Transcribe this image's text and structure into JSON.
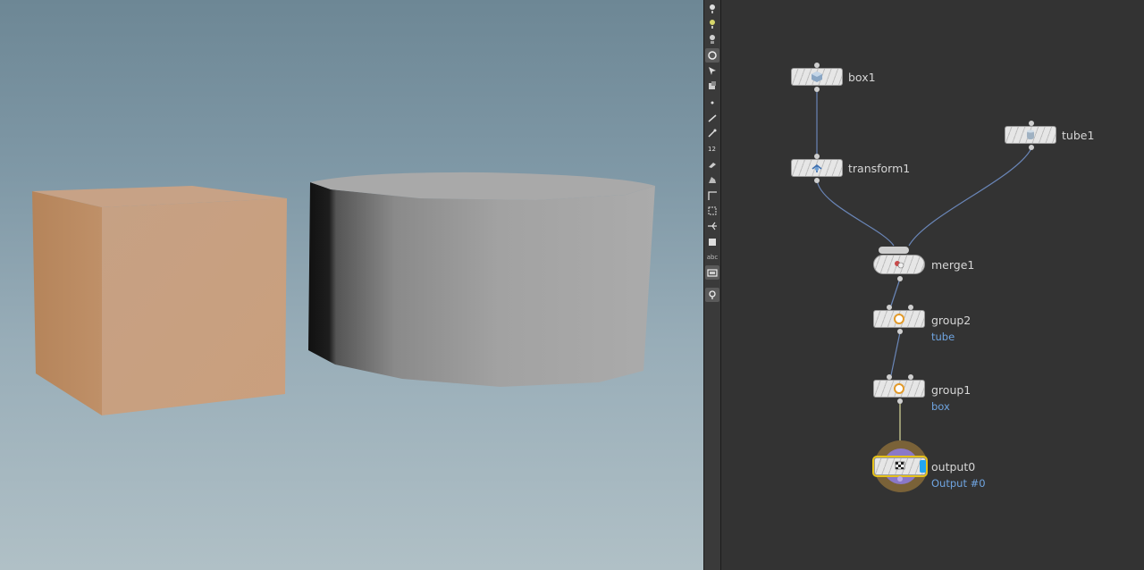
{
  "viewport": {
    "box_color": "#c9a283",
    "tube_color": "#a8a8a8"
  },
  "shelf": {
    "tools": [
      "light-icon",
      "light-icon",
      "light-icon",
      "camera-icon",
      "select-icon",
      "transform-icon",
      "handle-icon",
      "point-icon",
      "edge-icon",
      "pen-icon",
      "number-icon",
      "brush-icon",
      "sculpt-icon",
      "corner-icon",
      "snap-icon",
      "join-icon",
      "box-icon",
      "text-icon",
      "view-icon",
      "pin-icon"
    ],
    "text_tool_label": "abc"
  },
  "network": {
    "wire_color": "#6a86b8",
    "selected_color": "#e6c21a",
    "nodes": {
      "box1": {
        "name": "box1"
      },
      "transform1": {
        "name": "transform1"
      },
      "tube1": {
        "name": "tube1"
      },
      "merge1": {
        "name": "merge1"
      },
      "group2": {
        "name": "group2",
        "comment": "tube"
      },
      "group1": {
        "name": "group1",
        "comment": "box"
      },
      "output0": {
        "name": "output0",
        "comment": "Output #0"
      }
    }
  }
}
